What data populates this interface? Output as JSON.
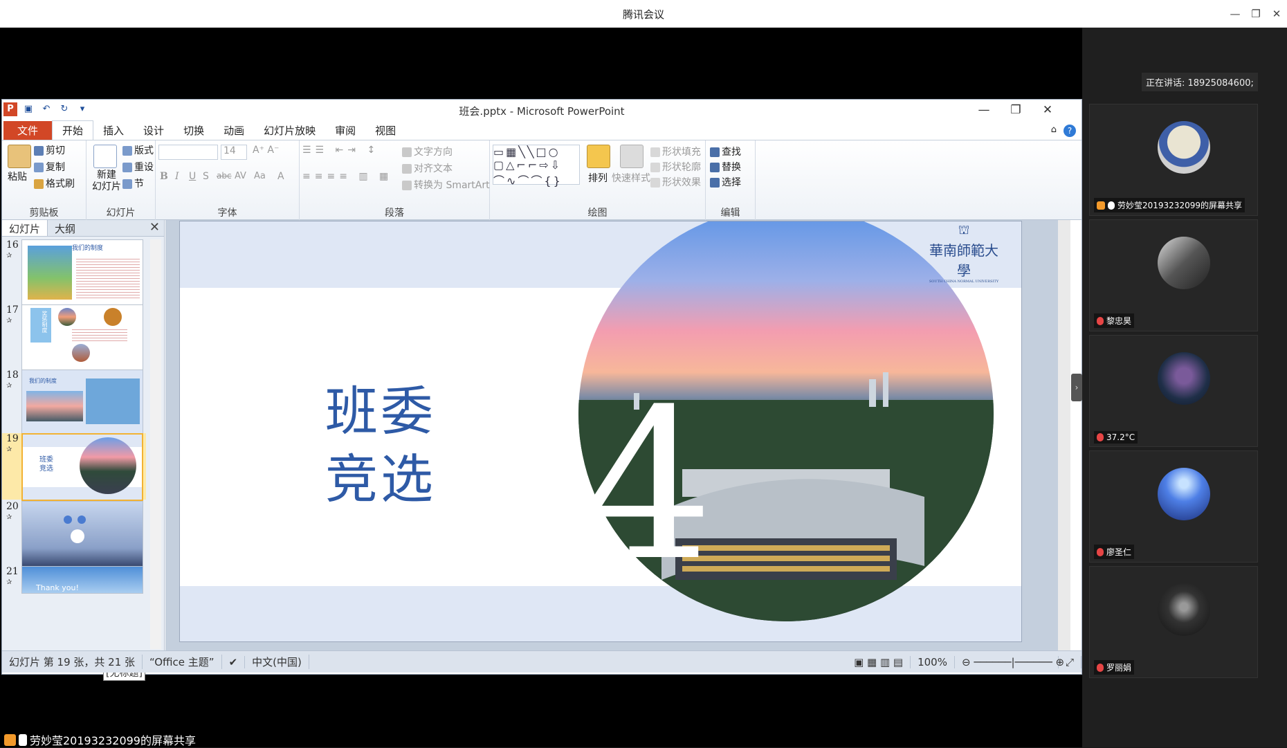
{
  "meeting": {
    "title": "腾讯会议",
    "window_controls": [
      "—",
      "❐",
      "✕"
    ],
    "share_label": "劳妙莹20193232099的屏幕共享",
    "speaking_label": "正在讲话: 18925084600;"
  },
  "ppt": {
    "title": "班会.pptx - Microsoft PowerPoint",
    "logo": "P",
    "window_controls": [
      "—",
      "❐",
      "✕"
    ],
    "tabs": [
      "文件",
      "开始",
      "插入",
      "设计",
      "切换",
      "动画",
      "幻灯片放映",
      "审阅",
      "视图"
    ],
    "active_tab": "开始",
    "ribbon": {
      "clipboard": {
        "paste": "粘贴",
        "cut": "剪切",
        "copy": "复制",
        "format_painter": "格式刷",
        "label": "剪贴板"
      },
      "slides": {
        "new_slide": "新建\n幻灯片",
        "layout": "版式",
        "reset": "重设",
        "section": "节",
        "label": "幻灯片"
      },
      "font": {
        "size": "14",
        "bold": "B",
        "italic": "I",
        "underline": "U",
        "shadow": "S",
        "strike": "abc",
        "spacing": "AV",
        "case": "Aa",
        "color": "A",
        "label": "字体"
      },
      "paragraph": {
        "text_direction": "文字方向",
        "align_text": "对齐文本",
        "smartart": "转换为 SmartArt",
        "label": "段落"
      },
      "drawing": {
        "arrange": "排列",
        "quick_styles": "快速样式",
        "fill": "形状填充",
        "outline": "形状轮廓",
        "effects": "形状效果",
        "label": "绘图"
      },
      "editing": {
        "find": "查找",
        "replace": "替换",
        "select": "选择",
        "label": "编辑"
      }
    },
    "pane_tabs": [
      "幻灯片",
      "大纲"
    ],
    "thumbnails": [
      {
        "num": "16",
        "heading": "我们的制度"
      },
      {
        "num": "17",
        "heading": "奖惩制度"
      },
      {
        "num": "18",
        "heading": "我们的制度"
      },
      {
        "num": "19",
        "heading": "班委\n竞选"
      },
      {
        "num": "20",
        "heading": ""
      },
      {
        "num": "21",
        "heading": "Thank you!"
      }
    ],
    "tooltip": "[无标题]",
    "slide": {
      "title_line1": "班委",
      "title_line2": "竞选",
      "number": "4",
      "logo_text": "華南師範大學",
      "logo_subtext": "SOUTH CHINA NORMAL UNIVERSITY"
    },
    "status": {
      "slide_info": "幻灯片 第 19 张，共 21 张",
      "theme": "“Office 主题”",
      "language": "中文(中国)",
      "zoom": "100%"
    }
  },
  "participants": [
    {
      "name": "劳妙莹20193232099的屏幕共享",
      "avatar": "cartoon"
    },
    {
      "name": "黎忠昊",
      "avatar": "photo"
    },
    {
      "name": "37.2°C",
      "avatar": "anime"
    },
    {
      "name": "廖圣仁",
      "avatar": "blue-lights"
    },
    {
      "name": "罗丽娟",
      "avatar": "dark"
    }
  ],
  "colors": {
    "ppt_accent": "#d24726",
    "slide_title": "#2e5aa6",
    "panel_bg": "#1f1f1f"
  }
}
